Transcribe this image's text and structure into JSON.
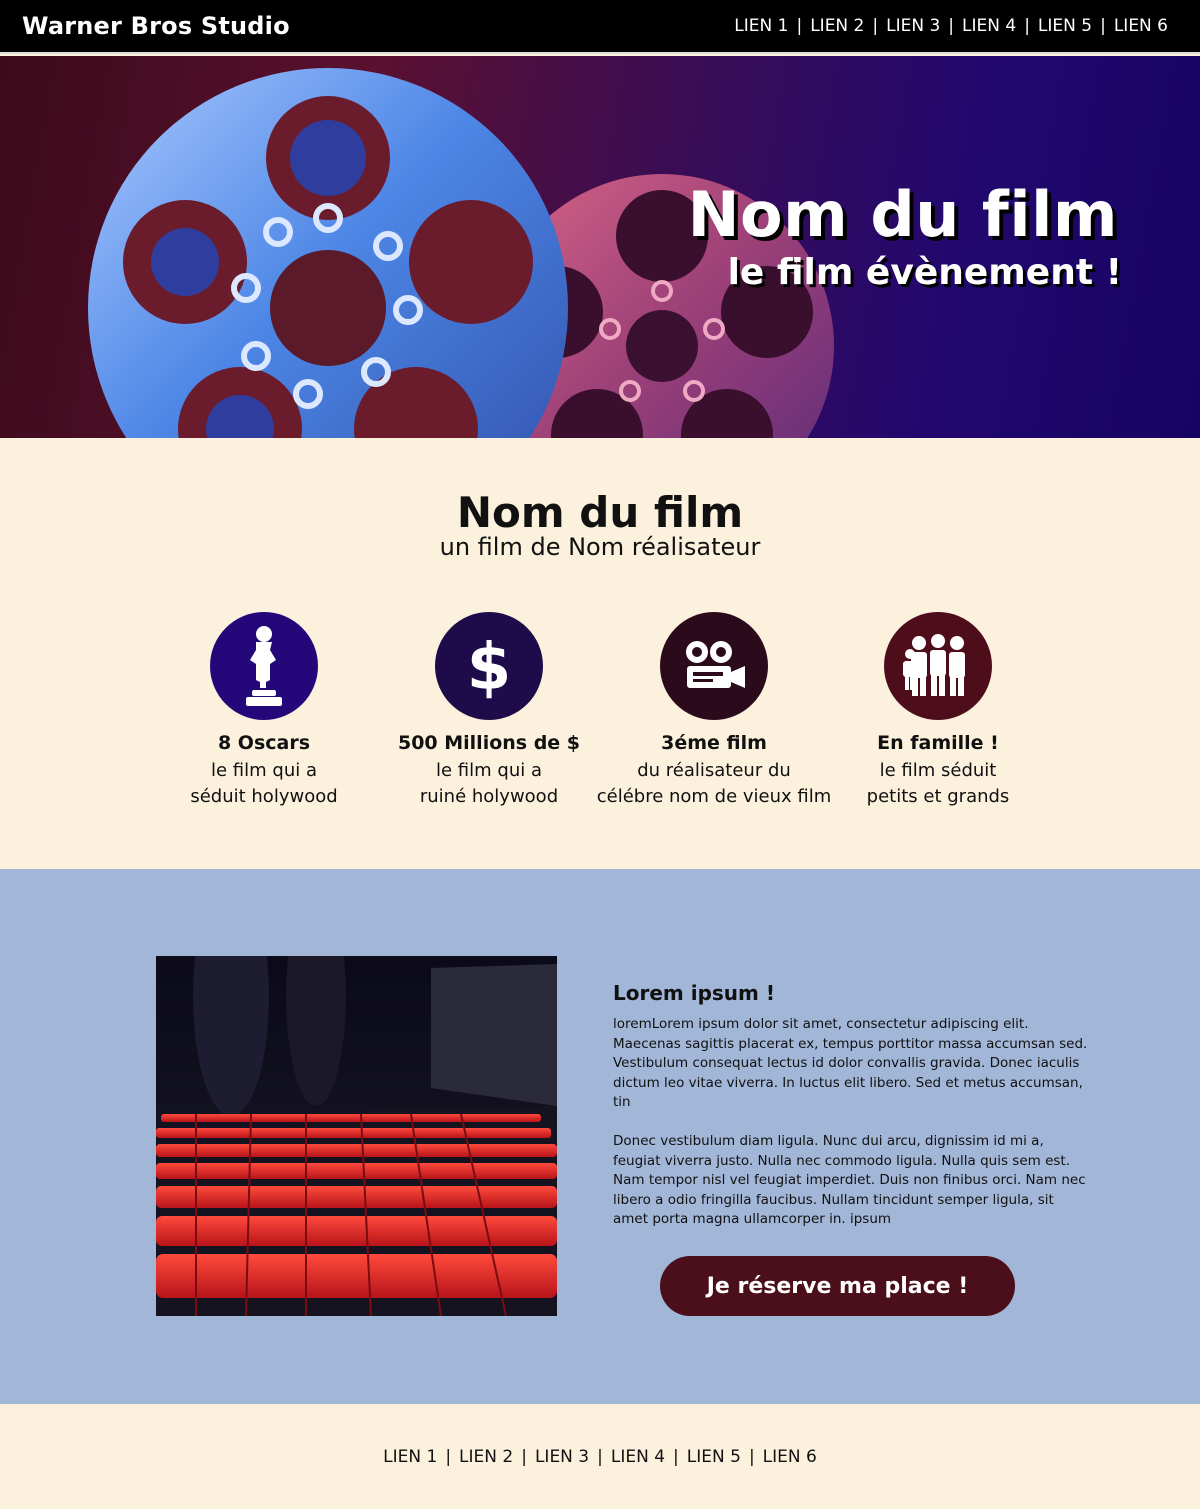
{
  "header": {
    "brand": "Warner Bros Studio",
    "nav": [
      "LIEN 1",
      "LIEN 2",
      "LIEN 3",
      "LIEN 4",
      "LIEN 5",
      "LIEN 6"
    ],
    "separator": "|"
  },
  "hero": {
    "title": "Nom du film",
    "subtitle": "le film évènement !"
  },
  "intro": {
    "title": "Nom du film",
    "subtitle": "un film de Nom réalisateur"
  },
  "features": [
    {
      "icon": "oscar-statue-icon",
      "color": "#24087a",
      "title": "8 Oscars",
      "line1": "le film qui a",
      "line2": "séduit holywood"
    },
    {
      "icon": "dollar-icon",
      "color": "#1d0b4a",
      "title": "500 Millions de $",
      "line1": "le film qui a",
      "line2": "ruiné holywood"
    },
    {
      "icon": "movie-camera-icon",
      "color": "#2b0a1c",
      "title": "3éme film",
      "line1": "du réalisateur du",
      "line2": "célébre nom de vieux film"
    },
    {
      "icon": "family-icon",
      "color": "#4d0d1b",
      "title": "En famille !",
      "line1": "le film séduit",
      "line2": "petits et grands"
    }
  ],
  "content": {
    "title": "Lorem ipsum !",
    "paragraph1": "loremLorem ipsum dolor sit amet, consectetur adipiscing elit. Maecenas sagittis placerat ex, tempus porttitor massa accumsan sed. Vestibulum consequat lectus id dolor convallis gravida. Donec iaculis dictum leo vitae viverra. In luctus elit libero. Sed et metus accumsan, tin",
    "paragraph2": "Donec vestibulum diam ligula. Nunc dui arcu, dignissim id mi a, feugiat viverra justo. Nulla nec commodo ligula. Nulla quis sem est. Nam tempor nisl vel feugiat imperdiet. Duis non finibus orci. Nam nec libero a odio fringilla faucibus. Nullam tincidunt semper ligula, sit amet porta magna ullamcorper in. ipsum",
    "cta": "Je réserve ma place !"
  },
  "footer": {
    "nav": [
      "LIEN 1",
      "LIEN 2",
      "LIEN 3",
      "LIEN 4",
      "LIEN 5",
      "LIEN 6"
    ],
    "separator": "|"
  },
  "colors": {
    "header_bg": "#000000",
    "page_bg": "#fcf1dd",
    "section_blue": "#a2b6d8",
    "cta_bg": "#4b0e1b"
  }
}
